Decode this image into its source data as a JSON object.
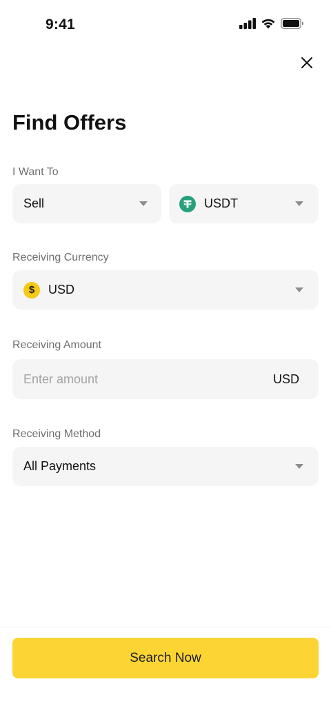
{
  "status_bar": {
    "time": "9:41"
  },
  "page": {
    "title": "Find Offers"
  },
  "i_want_to": {
    "label": "I Want To",
    "action": "Sell",
    "asset": "USDT"
  },
  "receiving_currency": {
    "label": "Receiving Currency",
    "value": "USD",
    "icon_symbol": "$"
  },
  "receiving_amount": {
    "label": "Receiving Amount",
    "placeholder": "Enter amount",
    "value": "",
    "unit": "USD"
  },
  "receiving_method": {
    "label": "Receiving Method",
    "value": "All Payments"
  },
  "search_button": {
    "label": "Search Now"
  },
  "icons": {
    "close": "close-icon",
    "usdt": "tether-icon",
    "usd": "dollar-coin-icon",
    "dropdown": "caret-down-icon"
  },
  "colors": {
    "accent": "#fcd535",
    "field_bg": "#f5f5f5",
    "label": "#6e6e6e",
    "usdt_green": "#26a17b",
    "usd_yellow": "#f5c915"
  }
}
